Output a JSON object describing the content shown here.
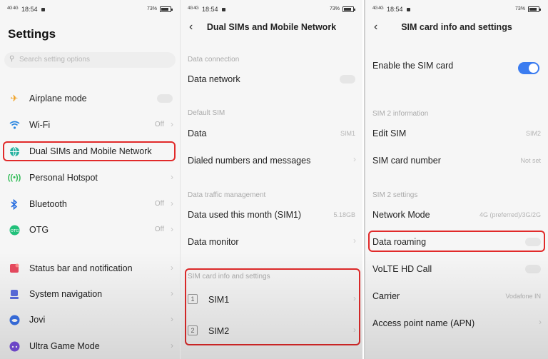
{
  "status": {
    "signal": "4G 4G",
    "time": "18:54",
    "battery": "73%"
  },
  "settings": {
    "title": "Settings",
    "search_placeholder": "Search setting options",
    "items": [
      {
        "label": "Airplane mode",
        "icon": "airplane-icon",
        "value": "",
        "color": "#f0a020"
      },
      {
        "label": "Wi-Fi",
        "icon": "wifi-icon",
        "value": "Off",
        "color": "#2a86e0"
      },
      {
        "label": "Dual SIMs and Mobile Network",
        "icon": "globe-icon",
        "value": "",
        "color": "#27b2a0"
      },
      {
        "label": "Personal Hotspot",
        "icon": "hotspot-icon",
        "value": "",
        "color": "#2fbb55"
      },
      {
        "label": "Bluetooth",
        "icon": "bluetooth-icon",
        "value": "Off",
        "color": "#2a6fe0"
      },
      {
        "label": "OTG",
        "icon": "otg-icon",
        "value": "Off",
        "color": "#21c07a"
      },
      {
        "label": "Status bar and notification",
        "icon": "notification-icon",
        "value": "",
        "color": "#e84a5f"
      },
      {
        "label": "System navigation",
        "icon": "navigation-icon",
        "value": "",
        "color": "#5b6de0"
      },
      {
        "label": "Jovi",
        "icon": "jovi-icon",
        "value": "",
        "color": "#3a72e8"
      },
      {
        "label": "Ultra Game Mode",
        "icon": "game-icon",
        "value": "",
        "color": "#7a4fe0"
      }
    ]
  },
  "dual_sim": {
    "title": "Dual SIMs and Mobile Network",
    "sec_data_connection": "Data connection",
    "data_network": "Data network",
    "sec_default_sim": "Default SIM",
    "data_label": "Data",
    "data_value": "SIM1",
    "dialed": "Dialed numbers and messages",
    "sec_traffic": "Data traffic management",
    "data_used": "Data used this month (SIM1)",
    "data_used_value": "5.18GB",
    "data_monitor": "Data monitor",
    "sec_sim_info": "SIM card info and settings",
    "sim1": "SIM1",
    "sim1_box": "1",
    "sim2": "SIM2",
    "sim2_box": "2"
  },
  "sim_info": {
    "title": "SIM card info and settings",
    "enable": "Enable the SIM card",
    "sec_info": "SIM 2 information",
    "edit_sim": "Edit SIM",
    "edit_sim_value": "SIM2",
    "sim_number": "SIM card number",
    "sim_number_value": "Not set",
    "sec_settings": "SIM 2 settings",
    "network_mode": "Network Mode",
    "network_mode_value": "4G (preferred)/3G/2G",
    "data_roaming": "Data roaming",
    "volte": "VoLTE HD Call",
    "carrier": "Carrier",
    "carrier_value": "Vodafone IN",
    "apn": "Access point name (APN)"
  },
  "colors": {
    "highlight": "#e12a2a",
    "toggle_on": "#3b7cf0"
  }
}
